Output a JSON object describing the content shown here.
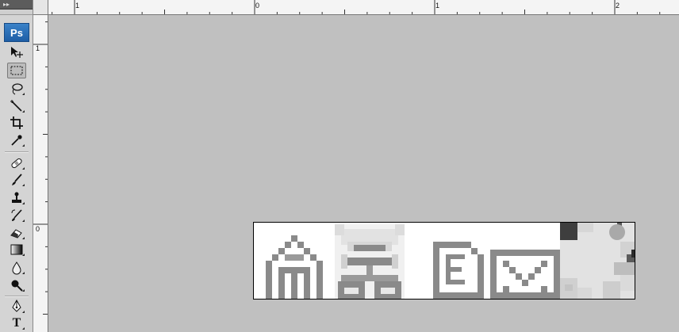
{
  "toolbox": {
    "collapse_glyph": "▸▸",
    "logo": "Ps",
    "type_tool_label": "T",
    "tools": [
      {
        "name": "move-tool",
        "icon": "move-icon"
      },
      {
        "name": "rectangular-marquee-tool",
        "icon": "marquee-icon",
        "active": true
      },
      {
        "name": "lasso-tool",
        "icon": "lasso-icon"
      },
      {
        "name": "magic-wand-tool",
        "icon": "magic-wand-icon"
      },
      {
        "name": "crop-tool",
        "icon": "crop-icon"
      },
      {
        "name": "eyedropper-tool",
        "icon": "eyedropper-icon"
      },
      {
        "name": "healing-brush-tool",
        "icon": "bandage-icon"
      },
      {
        "name": "brush-tool",
        "icon": "brush-icon"
      },
      {
        "name": "clone-stamp-tool",
        "icon": "stamp-icon"
      },
      {
        "name": "history-brush-tool",
        "icon": "history-brush-icon"
      },
      {
        "name": "eraser-tool",
        "icon": "eraser-icon"
      },
      {
        "name": "gradient-tool",
        "icon": "gradient-icon"
      },
      {
        "name": "blur-tool",
        "icon": "droplet-icon"
      },
      {
        "name": "dodge-tool",
        "icon": "dodge-icon"
      },
      {
        "name": "pen-tool",
        "icon": "pen-icon"
      },
      {
        "name": "type-tool",
        "icon": "type-icon"
      }
    ]
  },
  "rulers": {
    "top_labels": [
      "1",
      "0",
      "1",
      "2"
    ],
    "left_labels": [
      "1",
      "0"
    ]
  },
  "document": {
    "icons": [
      "home-icon",
      "sitemap-icon",
      "document-e-icon",
      "mail-icon",
      "blurred-patch"
    ]
  }
}
